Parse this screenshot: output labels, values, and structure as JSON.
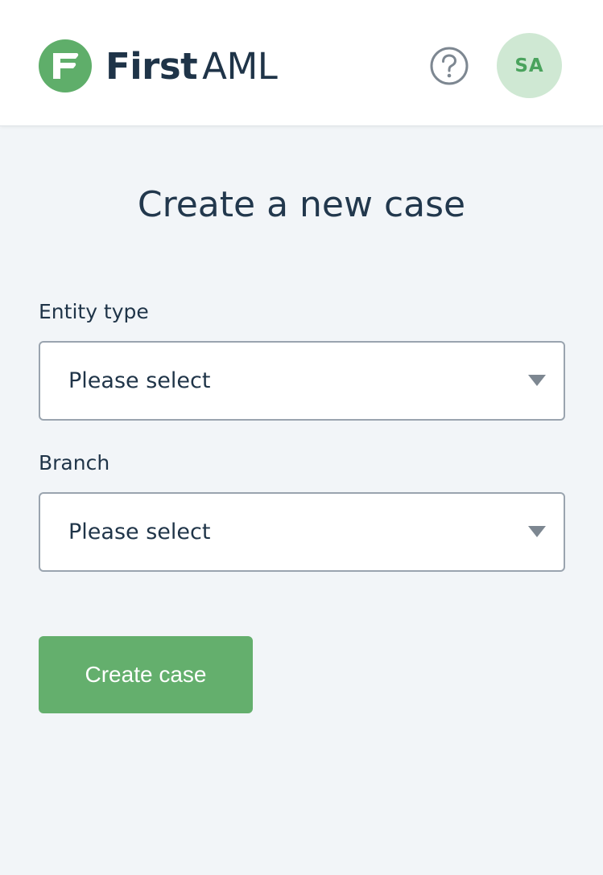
{
  "header": {
    "logo": {
      "first": "First",
      "aml": "AML",
      "icon": "first-aml-logo-icon",
      "color": "#5fae6a"
    },
    "help_icon": "question-circle-icon",
    "avatar_initials": "SA",
    "avatar_bg": "#cfe8d3",
    "avatar_fg": "#4aa35d"
  },
  "main": {
    "title": "Create a new case",
    "fields": [
      {
        "label": "Entity type",
        "value": "Please select",
        "icon": "caret-down-icon"
      },
      {
        "label": "Branch",
        "value": "Please select",
        "icon": "caret-down-icon"
      }
    ],
    "submit_label": "Create case",
    "accent": "#64af6d"
  }
}
